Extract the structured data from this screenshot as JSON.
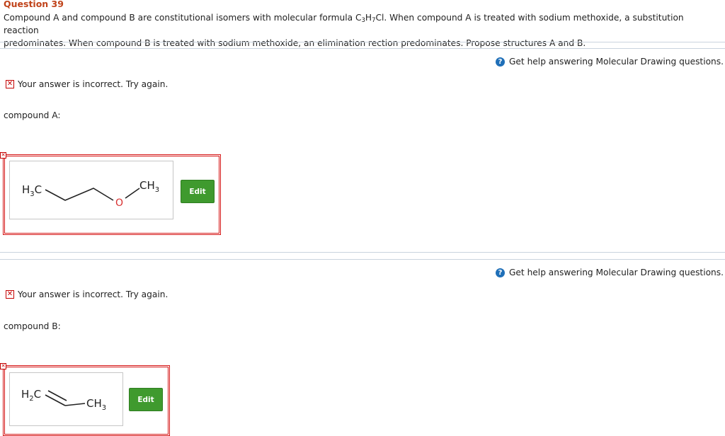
{
  "question": {
    "title": "Question 39",
    "text_line1": "Compound A and compound B are constitutional isomers with molecular formula C",
    "formula_sub1": "3",
    "formula_mid": "H",
    "formula_sub2": "7",
    "formula_end": "Cl. When compound A is treated with sodium methoxide, a substitution reaction",
    "text_line2": "predominates. When compound B is treated with sodium methoxide, an elimination rection predominates. Propose structures A and B."
  },
  "parts": [
    {
      "help_label": "Get help answering Molecular Drawing questions.",
      "feedback": "Your answer is incorrect.  Try again.",
      "label": "compound A:",
      "edit_label": "Edit",
      "molecule": {
        "atoms": [
          "H3C",
          "O",
          "CH3"
        ]
      }
    },
    {
      "help_label": "Get help answering Molecular Drawing questions.",
      "feedback": "Your answer is incorrect.  Try again.",
      "label": "compound B:",
      "edit_label": "Edit",
      "molecule": {
        "atoms": [
          "H2C",
          "CH3"
        ]
      }
    }
  ],
  "icons": {
    "help": "help-circle-icon",
    "incorrect": "x-box-icon"
  },
  "colors": {
    "title": "#c0431a",
    "error": "#d51515",
    "help_icon": "#1f6fb8",
    "edit_button": "#3f9a2e"
  }
}
